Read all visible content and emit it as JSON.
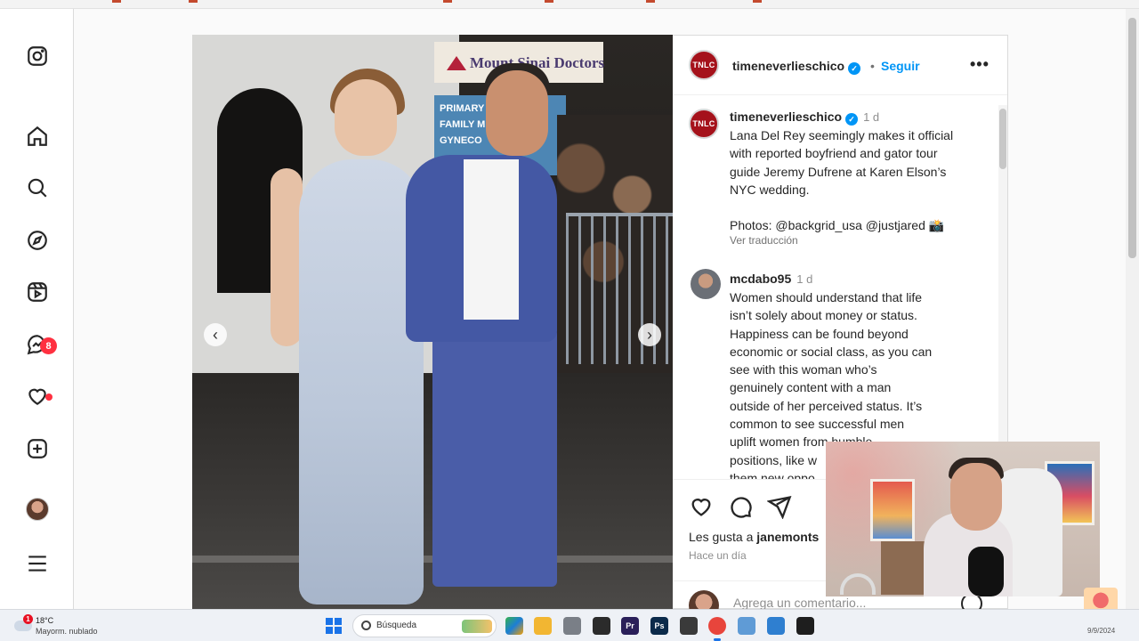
{
  "nav": {
    "items": [
      {
        "name": "instagram-logo-icon"
      },
      {
        "name": "home-icon"
      },
      {
        "name": "search-icon"
      },
      {
        "name": "explore-icon"
      },
      {
        "name": "reels-icon"
      },
      {
        "name": "messenger-icon"
      },
      {
        "name": "notifications-heart-icon"
      },
      {
        "name": "create-icon"
      },
      {
        "name": "profile-avatar"
      },
      {
        "name": "menu-icon"
      }
    ],
    "messages_badge": "8"
  },
  "post": {
    "photo_sign": "Mount Sinai Doctors",
    "photo_blue_sign": [
      "PRIMARY",
      "FAMILY ME",
      "GYNECO"
    ],
    "author": {
      "avatar_text": "TNLC",
      "handle": "timeneverlieschico",
      "verified": true
    },
    "separator": "•",
    "follow_label": "Seguir",
    "more_label": "•••"
  },
  "comments": [
    {
      "handle": "timeneverlieschico",
      "time": "1 d",
      "text_lines": [
        "Lana Del Rey seemingly makes it official",
        "with reported boyfriend and gator tour",
        "guide Jeremy Dufrene at Karen Elson’s",
        "NYC wedding."
      ],
      "photos_line": "Photos: @backgrid_usa @justjared 📸",
      "translate_label": "Ver traducción"
    },
    {
      "handle": "mcdabo95",
      "time": "1 d",
      "text_lines": [
        "Women should understand that life",
        "isn’t solely about money or status.",
        "Happiness can be found beyond",
        "economic or social class, as you can",
        "see with this woman who’s",
        "genuinely content with a man",
        "outside of her perceived status. It’s",
        "common to see successful men",
        "uplift women from humble",
        "positions, like w",
        "them new oppo"
      ]
    }
  ],
  "actions": {
    "likes_prefix": "Les gusta a ",
    "likes_user": "janemonts",
    "posted": "Hace un día",
    "comment_placeholder": "Agrega un comentario..."
  },
  "taskbar": {
    "weather_badge": "1",
    "temperature": "18°C",
    "condition": "Mayorm. nublado",
    "search_placeholder": "Búsqueda",
    "apps": [
      {
        "name": "file-explorer-icon",
        "color": "#f2b632",
        "label": ""
      },
      {
        "name": "settings-icon",
        "color": "#7a7f87",
        "label": ""
      },
      {
        "name": "media-app-icon",
        "color": "#2b2b2b",
        "label": ""
      },
      {
        "name": "premiere-pro-icon",
        "color": "#2a1f59",
        "label": "Pr"
      },
      {
        "name": "photoshop-icon",
        "color": "#0b2a4a",
        "label": "Ps"
      },
      {
        "name": "terminal-icon",
        "color": "#3a3a3a",
        "label": ""
      },
      {
        "name": "chrome-icon",
        "color": "#e8453c",
        "label": ""
      },
      {
        "name": "notepad-icon",
        "color": "#5f9bd6",
        "label": ""
      },
      {
        "name": "snipping-icon",
        "color": "#2f7fd0",
        "label": ""
      },
      {
        "name": "app-green-icon",
        "color": "#1e1e1e",
        "label": ""
      }
    ],
    "date": "9/9/2024"
  }
}
